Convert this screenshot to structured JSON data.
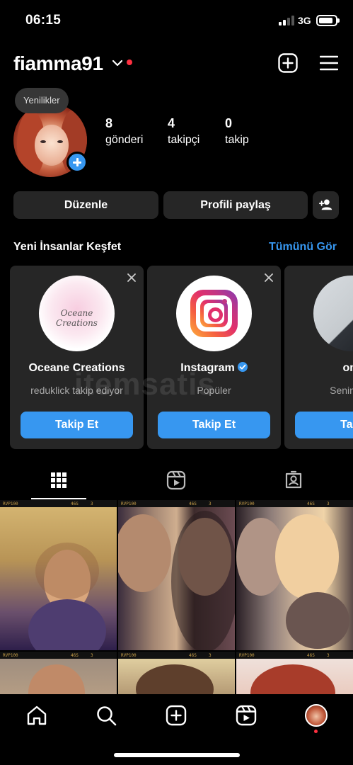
{
  "status_bar": {
    "time": "06:15",
    "network": "3G"
  },
  "header": {
    "username": "fiamma91"
  },
  "profile": {
    "notes_bubble": "Yenilikler",
    "stats": [
      {
        "value": "8",
        "label": "gönderi"
      },
      {
        "value": "4",
        "label": "takipçi"
      },
      {
        "value": "0",
        "label": "takip"
      }
    ]
  },
  "actions": {
    "edit_label": "Düzenle",
    "share_label": "Profili paylaş"
  },
  "discover": {
    "title": "Yeni İnsanlar Keşfet",
    "see_all": "Tümünü Gör",
    "cards": [
      {
        "name": "Oceane Creations",
        "subtitle": "reduklick takip ediyor",
        "button": "Takip Et",
        "image_text": "Oceane Creations"
      },
      {
        "name": "Instagram",
        "subtitle": "Popüler",
        "button": "Takip Et",
        "verified": true
      },
      {
        "name": "om",
        "subtitle": "Senin için",
        "button": "Taki"
      }
    ]
  },
  "watermark": "itemsatis",
  "film_strip": {
    "left_label": "RVP100",
    "right_label": "46S",
    "frame": "3"
  },
  "icons": {
    "header": [
      "chevron-down-icon",
      "new-post-icon",
      "menu-icon"
    ],
    "tabs": [
      "grid-icon",
      "reels-icon",
      "tagged-icon"
    ],
    "bottom_nav": [
      "home-icon",
      "search-icon",
      "create-icon",
      "reels-icon",
      "profile-avatar"
    ]
  },
  "colors": {
    "accent": "#3797f0",
    "notification": "#ff3040",
    "surface": "#262626"
  }
}
